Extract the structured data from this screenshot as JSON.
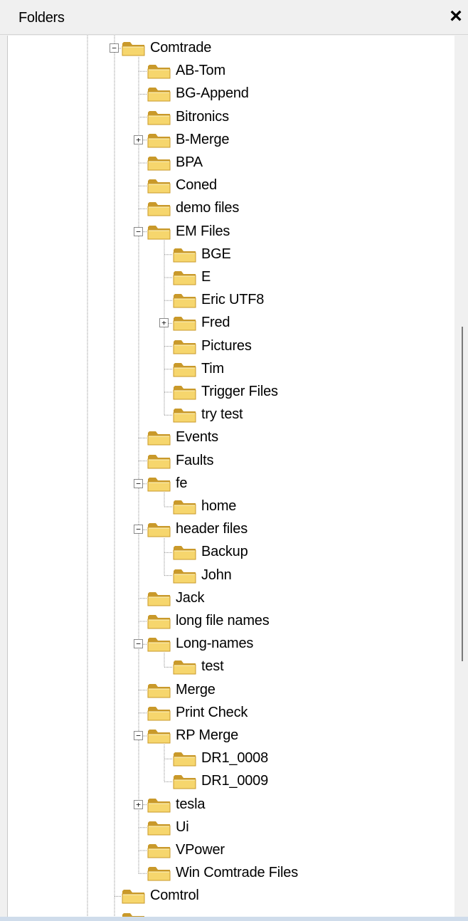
{
  "panel": {
    "title": "Folders",
    "close_label": "×"
  },
  "scrollbar": {
    "position_fraction": 0.33,
    "visible_fraction": 0.38
  },
  "colors": {
    "folder_body": "#f6d66d",
    "folder_dark": "#c9992a",
    "line": "#8c8c8c"
  },
  "tree": [
    {
      "label": "Comtrade",
      "level": 0,
      "toggle": "-",
      "children": [
        {
          "label": "AB-Tom",
          "level": 1
        },
        {
          "label": "BG-Append",
          "level": 1
        },
        {
          "label": "Bitronics",
          "level": 1
        },
        {
          "label": "B-Merge",
          "level": 1,
          "toggle": "+"
        },
        {
          "label": "BPA",
          "level": 1
        },
        {
          "label": "Coned",
          "level": 1
        },
        {
          "label": "demo files",
          "level": 1
        },
        {
          "label": "EM Files",
          "level": 1,
          "toggle": "-",
          "children": [
            {
              "label": "BGE",
              "level": 2
            },
            {
              "label": "E",
              "level": 2
            },
            {
              "label": "Eric UTF8",
              "level": 2
            },
            {
              "label": "Fred",
              "level": 2,
              "toggle": "+"
            },
            {
              "label": "Pictures",
              "level": 2
            },
            {
              "label": "Tim",
              "level": 2
            },
            {
              "label": "Trigger Files",
              "level": 2
            },
            {
              "label": "try test",
              "level": 2
            }
          ]
        },
        {
          "label": "Events",
          "level": 1
        },
        {
          "label": "Faults",
          "level": 1
        },
        {
          "label": "fe",
          "level": 1,
          "toggle": "-",
          "children": [
            {
              "label": "home",
              "level": 2
            }
          ]
        },
        {
          "label": "header files",
          "level": 1,
          "toggle": "-",
          "children": [
            {
              "label": "Backup",
              "level": 2
            },
            {
              "label": "John",
              "level": 2
            }
          ]
        },
        {
          "label": "Jack",
          "level": 1
        },
        {
          "label": "long file names",
          "level": 1
        },
        {
          "label": "Long-names",
          "level": 1,
          "toggle": "-",
          "children": [
            {
              "label": "test",
              "level": 2
            }
          ]
        },
        {
          "label": "Merge",
          "level": 1
        },
        {
          "label": "Print Check",
          "level": 1
        },
        {
          "label": "RP Merge",
          "level": 1,
          "toggle": "-",
          "children": [
            {
              "label": "DR1_0008",
              "level": 2
            },
            {
              "label": "DR1_0009",
              "level": 2
            }
          ]
        },
        {
          "label": "tesla",
          "level": 1,
          "toggle": "+"
        },
        {
          "label": "Ui",
          "level": 1
        },
        {
          "label": "VPower",
          "level": 1
        },
        {
          "label": "Win Comtrade Files",
          "level": 1
        }
      ]
    },
    {
      "label": "Comtrol",
      "level": 0
    }
  ]
}
